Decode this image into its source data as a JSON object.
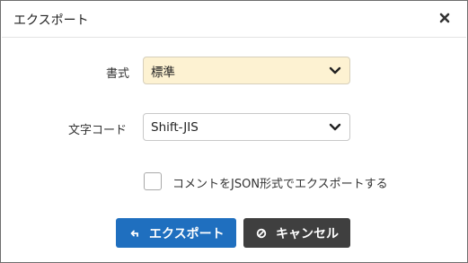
{
  "dialog": {
    "title": "エクスポート"
  },
  "format": {
    "label": "書式",
    "value": "標準"
  },
  "encoding": {
    "label": "文字コード",
    "value": "Shift-JIS"
  },
  "json_option": {
    "label": "コメントをJSON形式でエクスポートする",
    "checked": false
  },
  "buttons": {
    "export": "エクスポート",
    "cancel": "キャンセル"
  },
  "colors": {
    "primary": "#1f6fbf",
    "secondary": "#3f3f3f",
    "highlight": "#fdf2d2"
  }
}
